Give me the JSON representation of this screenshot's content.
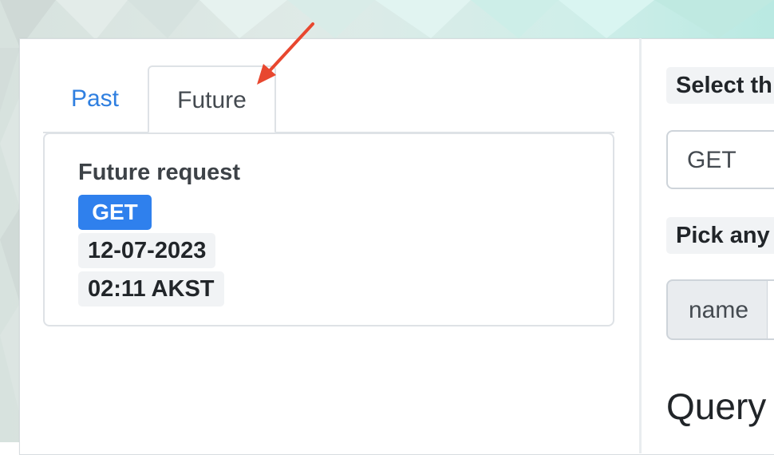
{
  "tabs": {
    "past_label": "Past",
    "future_label": "Future",
    "active": "Future"
  },
  "request_card": {
    "title": "Future request",
    "method": "GET",
    "date": "12-07-2023",
    "time": "02:11 AKST"
  },
  "right_panel": {
    "select_label": "Select th",
    "method_value": "GET",
    "pick_label": "Pick any",
    "name_addon": "name",
    "query_heading": "Query"
  },
  "colors": {
    "accent": "#2f80ed",
    "annotation_arrow": "#e8472f"
  }
}
